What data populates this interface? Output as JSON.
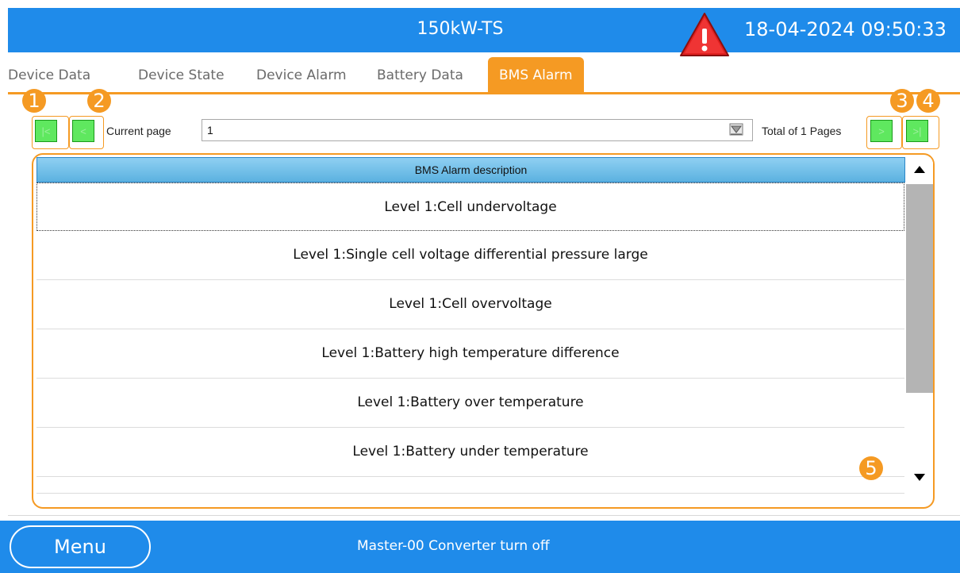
{
  "header": {
    "title": "150kW-TS",
    "datetime": "18-04-2024 09:50:33",
    "alarm_icon": "warning-triangle-icon",
    "color": "#1f8bea"
  },
  "tabs": [
    {
      "label": "Device Data"
    },
    {
      "label": "Device State"
    },
    {
      "label": "Device Alarm"
    },
    {
      "label": "Battery Data"
    },
    {
      "label": "BMS Alarm",
      "active": true
    }
  ],
  "pager": {
    "first_label": "|<",
    "prev_label": "<",
    "next_label": ">",
    "last_label": ">|",
    "current_page_label": "Current page",
    "current_page": "1",
    "total_label": "Total of 1 Pages"
  },
  "markers": [
    "1",
    "2",
    "3",
    "4",
    "5"
  ],
  "table": {
    "header": "BMS Alarm description",
    "rows": [
      "Level 1:Cell undervoltage",
      "Level 1:Single cell voltage differential pressure large",
      "Level 1:Cell overvoltage",
      "Level 1:Battery high temperature difference",
      "Level 1:Battery over temperature",
      "Level 1:Battery under temperature"
    ]
  },
  "footer": {
    "menu_label": "Menu",
    "status": "Master-00 Converter turn off"
  },
  "colors": {
    "accent": "#f59a23",
    "button_green": "#3fe23f",
    "header_blue": "#1f8bea"
  }
}
